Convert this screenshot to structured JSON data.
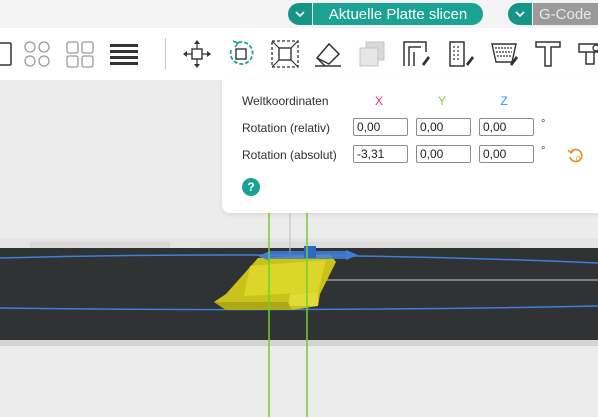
{
  "topbar": {
    "slice_label": "Aktuelle Platte slicen",
    "gcode_label": "G-Code",
    "accent": "#1aa395",
    "gcode_color": "#9a9a9a"
  },
  "toolbar": {
    "tools": [
      "arrange-icon",
      "arrange-grid-icon",
      "layers-icon",
      "move-icon",
      "rotate-icon",
      "scale-icon",
      "cut-icon",
      "support-icon",
      "seam-icon",
      "paint-support-icon",
      "fuzzy-skin-icon",
      "text-icon",
      "measure-icon"
    ],
    "active_tool": "rotate-icon"
  },
  "panel": {
    "header": "Weltkoordinaten",
    "axes": {
      "x": "X",
      "y": "Y",
      "z": "Z"
    },
    "axis_colors": {
      "x": "#e8336d",
      "y": "#8dc63f",
      "z": "#2b9adf"
    },
    "rows": [
      {
        "label": "Rotation (relativ)",
        "x": "0,00",
        "y": "0,00",
        "z": "0,00",
        "unit": "°"
      },
      {
        "label": "Rotation (absolut)",
        "x": "-3,31",
        "y": "0,00",
        "z": "0,00",
        "unit": "°"
      }
    ],
    "help": "?",
    "reset_icon": "reset-rotation-icon"
  }
}
